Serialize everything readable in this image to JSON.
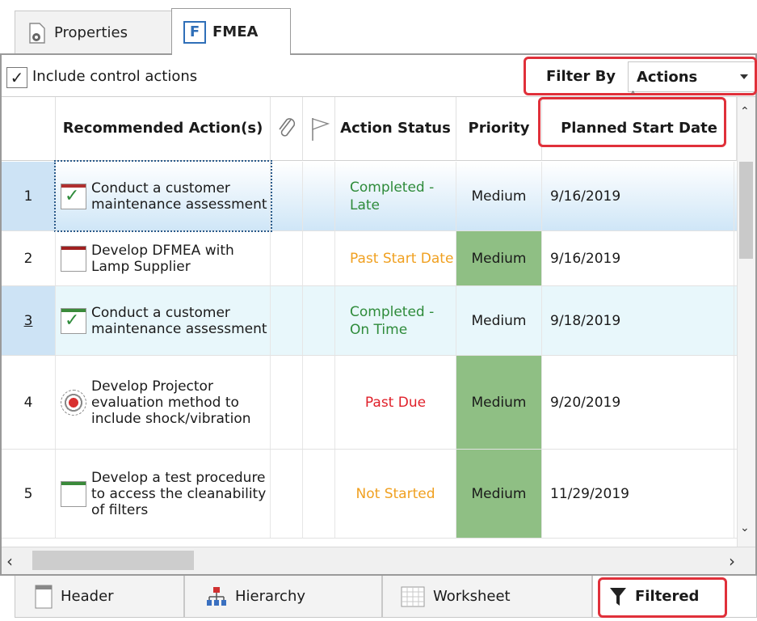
{
  "tabs": {
    "properties": "Properties",
    "fmea_badge": "F",
    "fmea": "FMEA"
  },
  "toolbar": {
    "include_checked": "✓",
    "include_label": "Include control actions",
    "filter_label": "Filter By",
    "filter_value": "Actions"
  },
  "columns": {
    "action": "Recommended Action(s)",
    "status": "Action Status",
    "priority": "Priority",
    "planned": "Planned Start Date",
    "sort_glyph": "˄"
  },
  "rows": [
    {
      "num": "1",
      "icon": "completed-check",
      "icon_bar": "#b03030",
      "action": "Conduct a customer maintenance assessment",
      "status": "Completed - Late",
      "status_color": "#2e8b3a",
      "priority": "Medium",
      "priority_highlight": false,
      "date": "9/16/2019",
      "selected": true
    },
    {
      "num": "2",
      "icon": "blank-task",
      "icon_bar": "#a02020",
      "action": "Develop DFMEA with Lamp Supplier",
      "status": "Past Start Date",
      "status_color": "#f0a020",
      "priority": "Medium",
      "priority_highlight": true,
      "date": "9/16/2019",
      "selected": false
    },
    {
      "num": "3",
      "icon": "completed-check",
      "icon_bar": "#3a8a3a",
      "action": "Conduct a customer maintenance assessment",
      "status": "Completed - On Time",
      "status_color": "#2e8b3a",
      "priority": "Medium",
      "priority_highlight": false,
      "date": "9/18/2019",
      "selected": false,
      "link": true
    },
    {
      "num": "4",
      "icon": "target",
      "icon_bar": "",
      "action": "Develop Projector evaluation method to include shock/vibration",
      "status": "Past Due",
      "status_color": "#e0202a",
      "priority": "Medium",
      "priority_highlight": true,
      "date": "9/20/2019",
      "selected": false
    },
    {
      "num": "5",
      "icon": "blank-task",
      "icon_bar": "#3a8a3a",
      "action": "Develop a test procedure to access the cleanability of filters",
      "status": "Not Started",
      "status_color": "#f0a020",
      "priority": "Medium",
      "priority_highlight": true,
      "date": "11/29/2019",
      "selected": false
    }
  ],
  "bottom_tabs": {
    "header": "Header",
    "hierarchy": "Hierarchy",
    "worksheet": "Worksheet",
    "filtered": "Filtered"
  },
  "colors": {
    "highlight_red": "#e0303a",
    "priority_green": "#8fbf84",
    "selected_row": "#cfe6f7",
    "alt_row": "#e8f7fb"
  }
}
